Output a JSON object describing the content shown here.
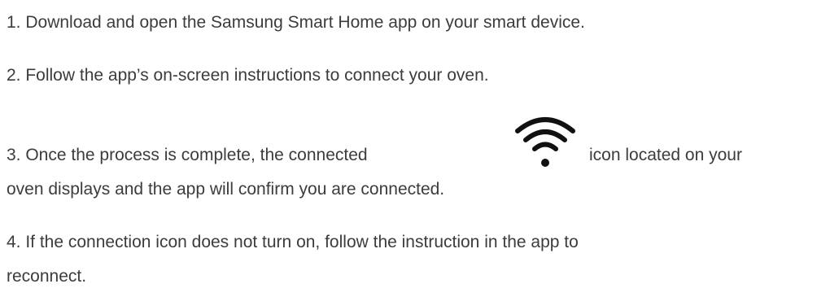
{
  "steps": {
    "step1": "1. Download and open the Samsung Smart Home app on your smart device.",
    "step2": "2. Follow the app’s on-screen instructions to connect your oven.",
    "step3_part1": "3. Once the process is complete, the connected",
    "step3_part2": "icon located on your",
    "step3_part3": "oven displays and the app will confirm you are connected.",
    "step4_line1": "4. If the connection icon does not turn on, follow the instruction in the app to",
    "step4_line2": "reconnect."
  },
  "icons": {
    "connected": "wifi-icon"
  },
  "colors": {
    "text": "#3c3c3c",
    "icon": "#111111",
    "background": "#ffffff"
  }
}
